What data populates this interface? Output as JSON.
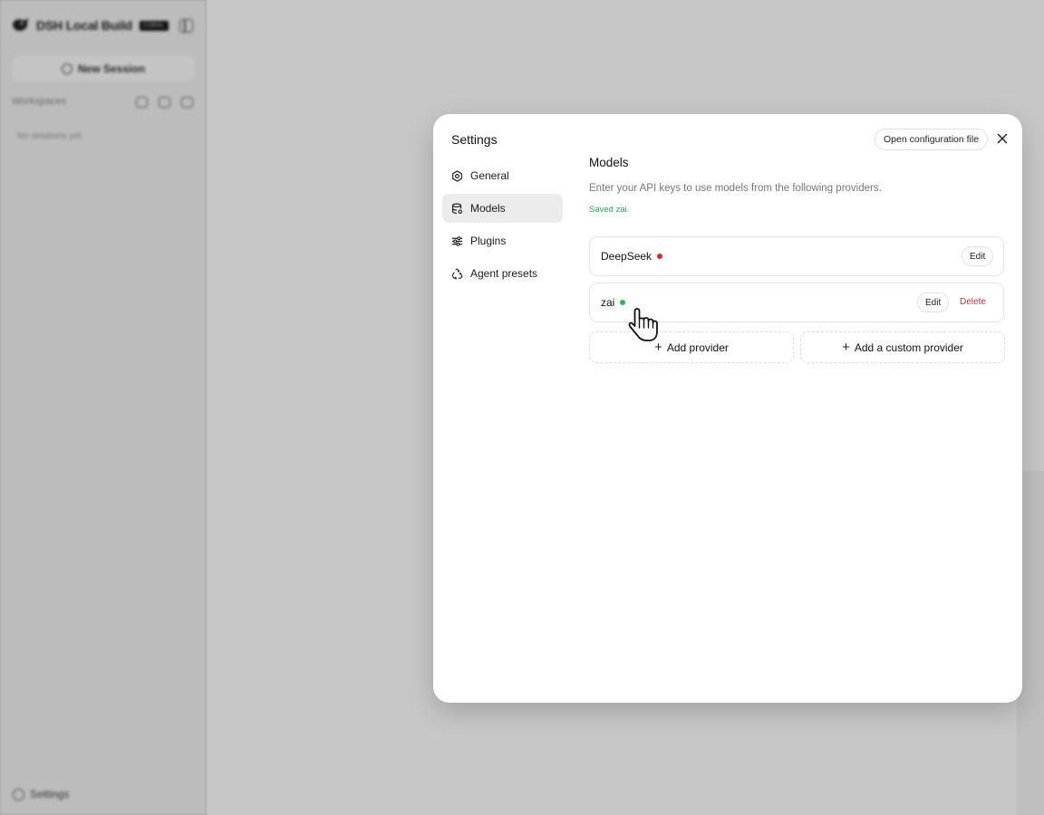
{
  "app": {
    "brand_name": "DSH Local Build",
    "brand_badge": "CORAL",
    "new_session_label": "New Session",
    "workspaces_label": "Workspaces",
    "no_sessions_text": "No sessions yet",
    "settings_label": "Settings"
  },
  "modal": {
    "title": "Settings",
    "open_config_label": "Open configuration file",
    "nav": [
      {
        "label": "General",
        "icon": "gear-icon"
      },
      {
        "label": "Models",
        "icon": "database-icon",
        "active": true
      },
      {
        "label": "Plugins",
        "icon": "sliders-icon"
      },
      {
        "label": "Agent presets",
        "icon": "recycle-icon"
      }
    ]
  },
  "models": {
    "title": "Models",
    "description": "Enter your API keys to use models from the following providers.",
    "saved_message": "Saved zai.",
    "providers": [
      {
        "name": "DeepSeek",
        "status_color": "#d42a2a",
        "edit_label": "Edit"
      },
      {
        "name": "zai",
        "status_color": "#2fb35f",
        "edit_label": "Edit",
        "delete_label": "Delete"
      }
    ],
    "add_provider_label": "Add provider",
    "add_custom_provider_label": "Add a custom provider"
  },
  "colors": {
    "saved_green": "#2ea55a",
    "delete_red": "#b0353f",
    "active_nav_bg": "#ececec"
  }
}
